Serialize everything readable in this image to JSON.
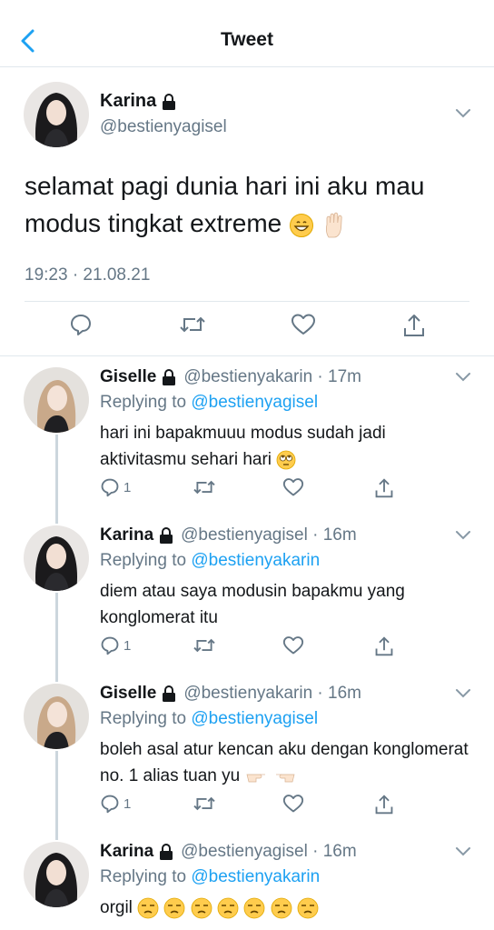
{
  "header": {
    "title": "Tweet",
    "back_icon": "chevron-left-icon"
  },
  "colors": {
    "accent": "#1da1f2",
    "secondary_text": "#657786",
    "divider": "#e1e8ed"
  },
  "main_tweet": {
    "name": "Karina",
    "handle": "@bestienyagisel",
    "text": "selamat pagi dunia hari ini aku mau modus tingkat extreme",
    "emojis": [
      "grinning-face-emoji",
      "raised-hand-emoji"
    ],
    "timestamp": "19:23 · 21.08.21",
    "actions": [
      "reply-icon",
      "retweet-icon",
      "like-icon",
      "share-icon"
    ]
  },
  "replies": [
    {
      "name": "Giselle",
      "meta": "@bestienyakarin · 17m",
      "replying_prefix": "Replying to",
      "replying_to": "@bestienyagisel",
      "text": "hari ini bapakmuuu modus sudah jadi aktivitasmu sehari hari",
      "emojis": [
        "rolling-eyes-emoji"
      ],
      "reply_count": "1"
    },
    {
      "name": "Karina",
      "meta": "@bestienyagisel · 16m",
      "replying_prefix": "Replying to",
      "replying_to": "@bestienyakarin",
      "text": "diem atau saya modusin bapakmu yang konglomerat itu",
      "emojis": [],
      "reply_count": "1"
    },
    {
      "name": "Giselle",
      "meta": "@bestienyakarin · 16m",
      "replying_prefix": "Replying to",
      "replying_to": "@bestienyagisel",
      "text": "boleh asal atur kencan aku dengan konglomerat no. 1 alias tuan yu",
      "emojis": [
        "pointing-hands-emoji"
      ],
      "reply_count": "1"
    },
    {
      "name": "Karina",
      "meta": "@bestienyagisel · 16m",
      "replying_prefix": "Replying to",
      "replying_to": "@bestienyakarin",
      "text": "orgil",
      "emojis": [
        "unamused-face-emoji"
      ],
      "reply_count": ""
    }
  ]
}
